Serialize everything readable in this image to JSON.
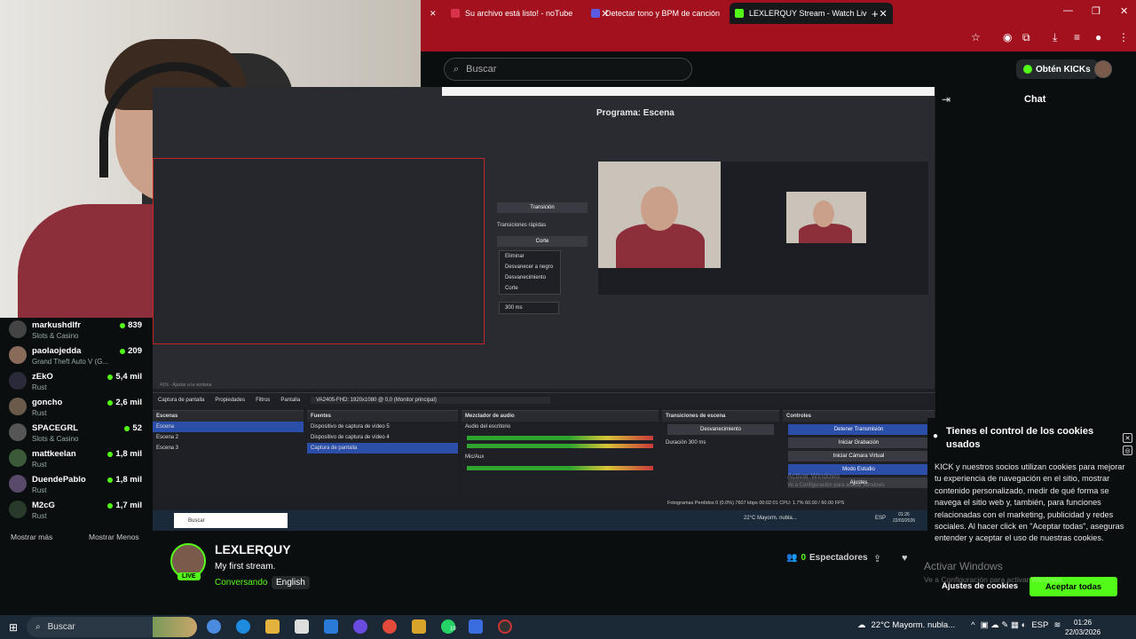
{
  "browser": {
    "tabs": [
      {
        "label": "Su archivo está listo! - noTube",
        "favicon_color": "#d6334a"
      },
      {
        "label": "Detectar tono y BPM de canción",
        "favicon_color": "#5b5be0"
      },
      {
        "label": "LEXLERQUY Stream - Watch Liv",
        "favicon_color": "#53fc18"
      }
    ],
    "new_tab_label": "+",
    "chrome_color": "#a3101e"
  },
  "header": {
    "search_placeholder": "Buscar",
    "kicks_label": "Obtén KICKs"
  },
  "sidebar": {
    "channels": [
      {
        "name": "markushdlfr",
        "category": "Slots & Casino",
        "viewers": "839"
      },
      {
        "name": "paolaojedda",
        "category": "Grand Theft Auto V (G...",
        "viewers": "209"
      },
      {
        "name": "zEkO",
        "category": "Rust",
        "viewers": "5,4 mil"
      },
      {
        "name": "goncho",
        "category": "Rust",
        "viewers": "2,6 mil"
      },
      {
        "name": "SPACEGRL",
        "category": "Slots & Casino",
        "viewers": "52"
      },
      {
        "name": "mattkeelan",
        "category": "Rust",
        "viewers": "1,8 mil"
      },
      {
        "name": "DuendePablo",
        "category": "Rust",
        "viewers": "1,8 mil"
      },
      {
        "name": "M2cG",
        "category": "Rust",
        "viewers": "1,7 mil"
      }
    ],
    "show_more": "Mostrar más",
    "show_less": "Mostrar Menos"
  },
  "obs": {
    "program_title": "Programa: Escena",
    "transition_label": "Transición",
    "quick_transitions": "Transiciones rápidas",
    "cut_label": "Corte",
    "dropdown_items": [
      "Eliminar",
      "Desvanecer a negro",
      "Desvanecimiento",
      "Corte"
    ],
    "duration_ms": "300 ms",
    "source_toolbar": [
      "Captura de pantalla",
      "Propiedades",
      "Filtros",
      "Pantalla",
      "VA2405-FHD: 1920x1080 @ 0,0 (Monitor principal)"
    ],
    "scenes_header": "Escenas",
    "scenes": [
      "Escena",
      "Escena 2",
      "Escena 3"
    ],
    "sources_header": "Fuentes",
    "sources": [
      "Dispositivo de captura de vídeo 5",
      "Dispositivo de captura de vídeo 4",
      "Captura de pantalla"
    ],
    "mixer_header": "Mezclador de audio",
    "mixer_tracks": [
      "Audio del escritorio",
      "Mic/Aux"
    ],
    "mixer_db": "0.0 dB",
    "transitions_header": "Transiciones de escena",
    "transition_value": "Desvanecimiento",
    "duration_label": "Duración",
    "controls_header": "Controles",
    "controls": [
      "Detener Transmisión",
      "Iniciar Grabación",
      "Iniciar Cámara Virtual",
      "Modo Estudio",
      "Ajustes"
    ],
    "status_bar": "Fotogramas Perdidos 0 (0.0%)   7607 kbps   00:02:01   CPU: 1.7%   60.00 / 60.00 FPS",
    "zoom": "41%",
    "fit_label": "Ajustar a la ventana",
    "inner_search": "Buscar",
    "inner_weather": "22°C  Mayorm. nubla...",
    "inner_lang": "ESP",
    "inner_time": "01:26",
    "inner_date": "22/03/2026",
    "activate": "Activar Windows",
    "activate_sub": "Ve a Configuración para activar Windows"
  },
  "stream": {
    "streamer": "LEXLERQUY",
    "title": "My first stream.",
    "category": "Conversando",
    "language": "English",
    "live_badge": "LIVE",
    "viewers_count": "0",
    "viewers_label": "Espectadores"
  },
  "chat": {
    "title": "Chat"
  },
  "cookie": {
    "title": "Tienes el control de los cookies usados",
    "body": "KICK y nuestros socios utilizan cookies para mejorar tu experiencia de navegación en el sitio, mostrar contenido personalizado, medir de qué forma se navega el sitio web y, también, para funciones relacionadas con el marketing, publicidad y redes sociales. Al hacer click en \"Aceptar todas\", aseguras entender y aceptar el uso de nuestras cookies.",
    "settings_label": "Ajustes de cookies",
    "accept_label": "Aceptar todas"
  },
  "watermark": {
    "title": "Activar Windows",
    "subtitle": "Ve a Configuración para activar Windows."
  },
  "taskbar": {
    "search": "Buscar",
    "weather": "22°C  Mayorm. nubla...",
    "lang": "ESP",
    "time": "01:26",
    "date": "22/03/2026",
    "whatsapp_badge": "19"
  },
  "colors": {
    "kick_green": "#53fc18",
    "background": "#0b0e0f",
    "obs_blue": "#2b4ea8"
  }
}
